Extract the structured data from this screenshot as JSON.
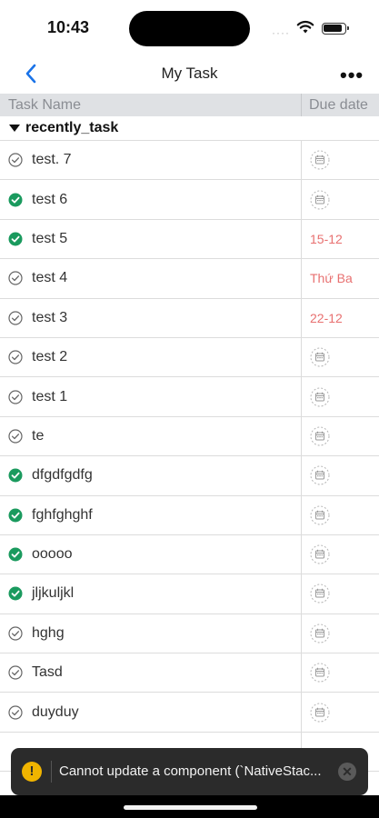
{
  "status_bar": {
    "time": "10:43",
    "signal_dots": "····"
  },
  "nav": {
    "title": "My Task",
    "more_label": "•••"
  },
  "table": {
    "col_task_name": "Task Name",
    "col_due_date": "Due date",
    "group_label": "recently_task",
    "rows": [
      {
        "name": "test. 7",
        "done": false,
        "due": ""
      },
      {
        "name": "test 6",
        "done": true,
        "due": ""
      },
      {
        "name": "test 5",
        "done": true,
        "due": "15-12"
      },
      {
        "name": "test 4",
        "done": false,
        "due": "Thứ Ba"
      },
      {
        "name": "test 3",
        "done": false,
        "due": "22-12"
      },
      {
        "name": "test 2",
        "done": false,
        "due": ""
      },
      {
        "name": "test 1",
        "done": false,
        "due": ""
      },
      {
        "name": "te",
        "done": false,
        "due": ""
      },
      {
        "name": "dfgdfgdfg",
        "done": true,
        "due": ""
      },
      {
        "name": "fghfghghf",
        "done": true,
        "due": ""
      },
      {
        "name": "ooooo",
        "done": true,
        "due": ""
      },
      {
        "name": "jljkuljkl",
        "done": true,
        "due": ""
      },
      {
        "name": "hghg",
        "done": false,
        "due": ""
      },
      {
        "name": "Tasd",
        "done": false,
        "due": ""
      },
      {
        "name": "duyduy",
        "done": false,
        "due": ""
      },
      {
        "name": "",
        "done": false,
        "due": ""
      }
    ]
  },
  "toast": {
    "message": "Cannot update a component (`NativeStac...",
    "icon": "warning-icon",
    "close_icon": "close-icon"
  },
  "colors": {
    "done_green": "#1a9a5e",
    "due_red": "#e87070",
    "header_bg": "#dfe1e4"
  }
}
